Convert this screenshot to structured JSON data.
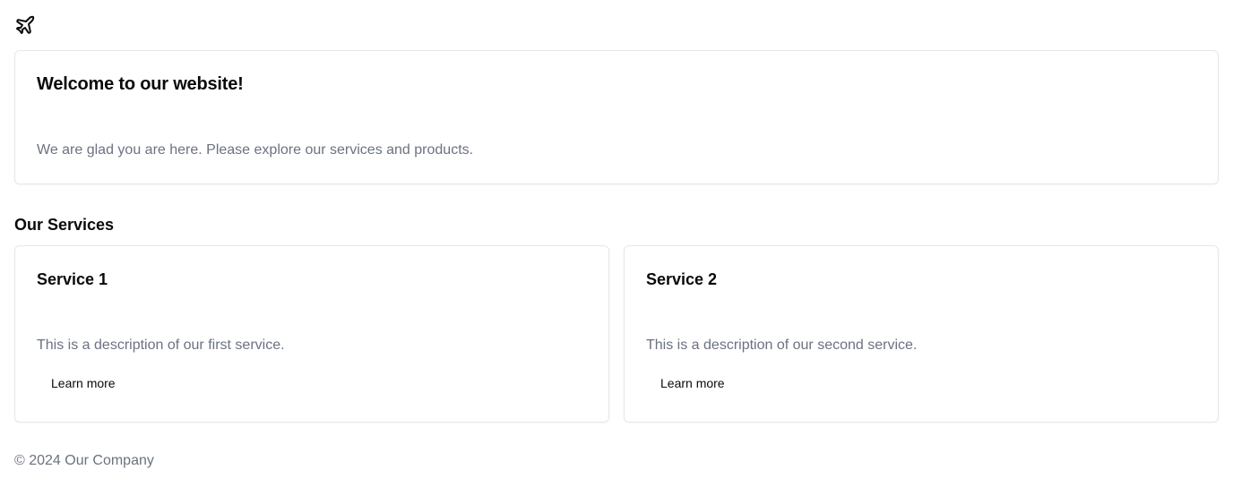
{
  "header": {
    "logo_icon": "plane-icon"
  },
  "welcome": {
    "title": "Welcome to our website!",
    "text": "We are glad you are here. Please explore our services and products."
  },
  "services": {
    "heading": "Our Services",
    "items": [
      {
        "title": "Service 1",
        "description": "This is a description of our first service.",
        "link_label": "Learn more"
      },
      {
        "title": "Service 2",
        "description": "This is a description of our second service.",
        "link_label": "Learn more"
      }
    ]
  },
  "footer": {
    "text": "© 2024 Our Company"
  },
  "colors": {
    "muted_text": "#6b7280",
    "border": "#e5e7eb",
    "text": "#0a0a0a"
  }
}
